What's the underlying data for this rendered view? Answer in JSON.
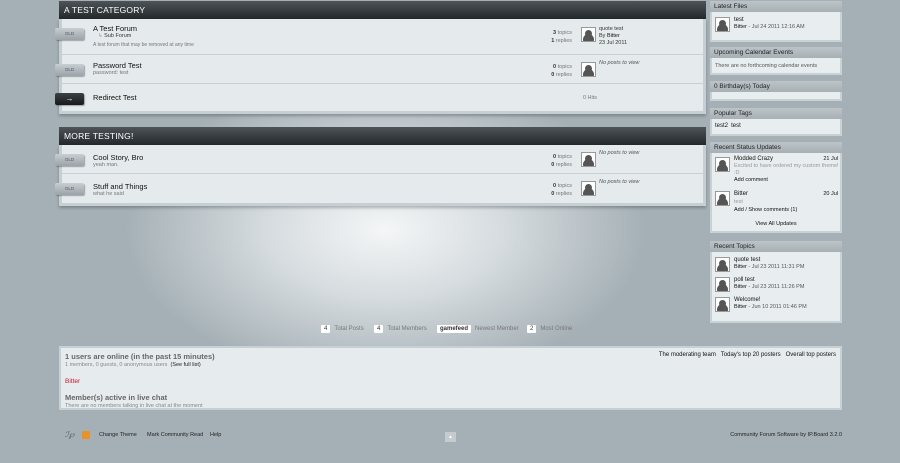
{
  "categories": [
    {
      "title": "A TEST CATEGORY",
      "forums": [
        {
          "name": "A Test Forum",
          "desc": "A test forum that may be removed at any time",
          "sub": "Sub Forum",
          "topics": "3",
          "topics_label": "topics",
          "replies": "1",
          "replies_label": "replies",
          "last_title": "quote test",
          "last_by": "By",
          "last_author": "Bitter",
          "last_date": "23 Jul 2011"
        },
        {
          "name": "Password Test",
          "desc": "password: test",
          "topics": "0",
          "topics_label": "topics",
          "replies": "0",
          "replies_label": "replies",
          "no_posts": "No posts to view"
        },
        {
          "name": "Redirect Test",
          "hits": "0 Hits",
          "redirect_icon": "→"
        }
      ]
    },
    {
      "title": "MORE TESTING!",
      "forums": [
        {
          "name": "Cool Story, Bro",
          "desc": "yeah man.",
          "topics": "0",
          "topics_label": "topics",
          "replies": "0",
          "replies_label": "replies",
          "no_posts": "No posts to view"
        },
        {
          "name": "Stuff and Things",
          "desc": "what he said",
          "topics": "0",
          "topics_label": "topics",
          "replies": "0",
          "replies_label": "replies",
          "no_posts": "No posts to view"
        }
      ]
    }
  ],
  "forum_tag": "OLD",
  "sidebar": {
    "latest_files": {
      "title": "Latest Files",
      "item": "test",
      "author": "Bitter",
      "date": "- Jul 24 2011 12:16 AM"
    },
    "calendar": {
      "title": "Upcoming Calendar Events",
      "text": "There are no forthcoming calendar events"
    },
    "birthdays": {
      "title": "0 Birthday(s) Today"
    },
    "tags": {
      "title": "Popular Tags",
      "items": [
        "test2",
        "test"
      ]
    },
    "status": {
      "title": "Recent Status Updates",
      "u1": {
        "name": "Modded Crazy",
        "date": "21 Jul",
        "text": "Excited to have ordered my custom theme! :D",
        "link": "Add comment"
      },
      "u2": {
        "name": "Bitter",
        "date": "20 Jul",
        "text": "test",
        "link": "Add / Show comments (1)"
      },
      "view_all": "View All Updates"
    },
    "topics": {
      "title": "Recent Topics",
      "items": [
        {
          "t": "quote test",
          "a": "Bitter",
          "d": "- Jul 23 2011 11:31 PM"
        },
        {
          "t": "poll test",
          "a": "Bitter",
          "d": "- Jul 23 2011 11:26 PM"
        },
        {
          "t": "Welcome!",
          "a": "Bitter",
          "d": "- Jun 10 2011 01:46 PM"
        }
      ]
    }
  },
  "board_stats": {
    "posts": "4",
    "posts_label": "Total Posts",
    "members": "4",
    "members_label": "Total Members",
    "newest": "gamefeed",
    "newest_label": "Newest Member",
    "online": "2",
    "online_label": "Most Online"
  },
  "online": {
    "title": "1 users are online (in the past 15 minutes)",
    "detail": "1 members, 0 guests, 0 anonymous users",
    "full_list": "(See full list)",
    "user": "Bitter",
    "links": [
      "The moderating team",
      "Today's top 20 posters",
      "Overall top posters"
    ],
    "chat_title": "Member(s) active in live chat",
    "chat_text": "There are no members talking in live chat at the moment"
  },
  "footer": {
    "links": [
      "Change Theme",
      "Mark Community Read",
      "Help"
    ],
    "credit": "Community Forum Software by IP.Board 3.2.0",
    "logo": "ipb",
    "rss": "rss",
    "top": "▲"
  }
}
